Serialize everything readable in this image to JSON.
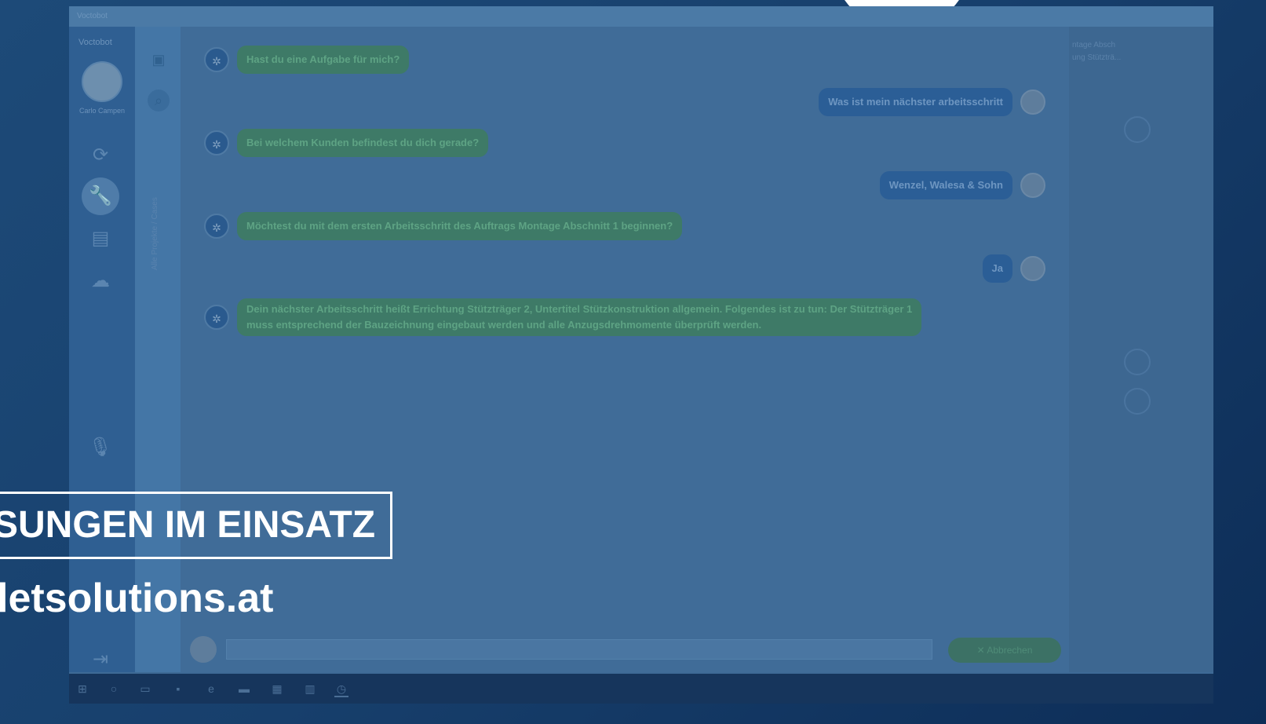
{
  "window": {
    "title": "Voctobot"
  },
  "sidebar": {
    "logo": "Voctobot",
    "user_name": "Carlo Campen",
    "icons": [
      "sync-icon",
      "wrench-icon",
      "clipboard-icon",
      "cloud-icon",
      "mic-icon",
      "logout-icon"
    ]
  },
  "panel2": {
    "vertical_label": "Alle Projekte / Cases"
  },
  "chat": {
    "messages": [
      {
        "from": "bot",
        "text": "Hast du eine Aufgabe für mich?"
      },
      {
        "from": "user",
        "text": "Was ist mein nächster arbeitsschritt"
      },
      {
        "from": "bot",
        "text": "Bei welchem Kunden befindest du dich gerade?"
      },
      {
        "from": "user",
        "text": "Wenzel, Walesa & Sohn"
      },
      {
        "from": "bot",
        "text": "Möchtest du mit dem ersten Arbeitsschritt des Auftrags Montage Abschnitt 1 beginnen?"
      },
      {
        "from": "user",
        "text": "Ja"
      },
      {
        "from": "bot",
        "line1": "Dein nächster Arbeitsschritt heißt Errichtung Stützträger 2, Untertitel Stützkonstruktion allgemein. Folgendes ist zu tun: Der Stützträger 1",
        "line2": "muss entsprechend der Bauzeichnung eingebaut werden und alle Anzugsdrehmomente überprüft werden."
      }
    ]
  },
  "composer": {
    "cancel_label": "Abbrechen"
  },
  "right_strip": {
    "line1": "ntage Absch",
    "line2": "ung Stützträ..."
  },
  "overlay": {
    "banner": "SUNGEN IM EINSATZ",
    "url": "letsolutions.at"
  },
  "colors": {
    "bot_bubble": "#3e7a67",
    "user_bubble": "#2b5e96",
    "banner_text": "#ffffff"
  }
}
